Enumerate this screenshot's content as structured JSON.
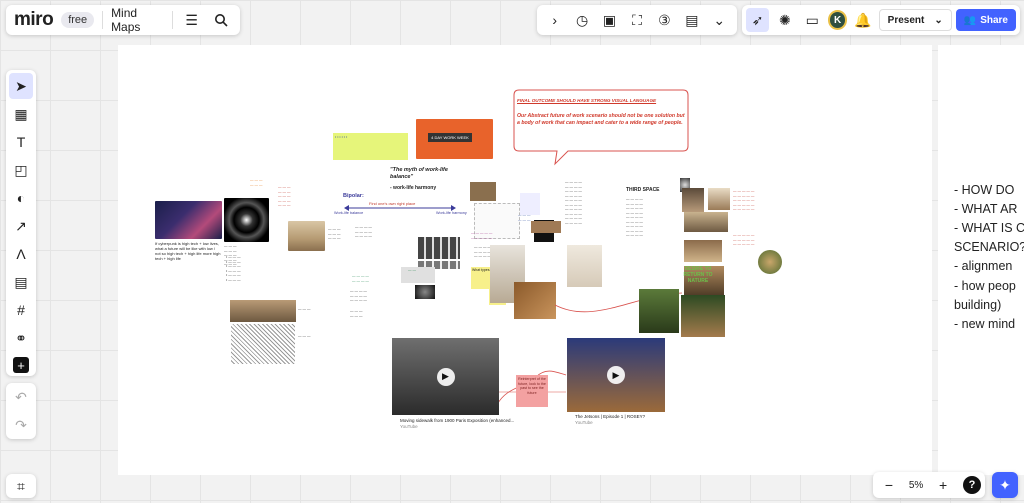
{
  "app": {
    "logo": "miro",
    "plan_badge": "free",
    "board_title": "Mind Maps",
    "menu_icon": "hamburger-icon",
    "search_icon": "search-icon"
  },
  "toolbar_top": {
    "icons": [
      "chevron-right-icon",
      "timer-icon",
      "voting-icon",
      "focus-icon",
      "card-3-icon",
      "notes-icon",
      "chevrons-down-icon"
    ]
  },
  "header_right": {
    "avatar_initial": "K",
    "present_label": "Present",
    "share_label": "Share",
    "accent": "#4262ff"
  },
  "left_tools": [
    "cursor-icon",
    "table-icon",
    "text-icon",
    "sticky-note-icon",
    "shapes-icon",
    "connector-icon",
    "pen-icon",
    "comment-icon",
    "frame-icon",
    "diagram-icon",
    "plus-icon"
  ],
  "zoom": {
    "minus": "−",
    "level": "5%",
    "plus": "+",
    "help": "?"
  },
  "right_frame_lines": [
    "- HOW DO",
    "- WHAT AR",
    "- WHAT IS C",
    "SCENARIO?",
    "- alignmen",
    "- how peop",
    "building)",
    "- new mind"
  ],
  "canvas": {
    "final_outcome_title": "FINAL OUTCOME SHOULD HAVE STRONG VISUAL LANGUAGE",
    "final_outcome_body": "Our Abstract future of work scenario should not be one solution but a body of work that can impact and cater to a wide range of people.",
    "myth_quote": "\"The myth of work-life balance\"",
    "work_life_harmony": "- work-life harmony",
    "bipolar_label": "Bipolar:",
    "find_balance": "Find one's own right place",
    "work_life_balance_label": "Work-life balance",
    "work_life_harmony_label": "Work-life harmony",
    "third_space": "THIRD SPACE",
    "desire_to_return": "DESIRE TO RETURN TO NATURE",
    "sticky_pink": "Reinterpret of the future, look to the past to see the future",
    "sticky_yellow_1": "What types...",
    "sticky_yellow_2": "Impact...",
    "video1_title": "Moving sidewalk from 1900 Paris Exposition (enhanced...",
    "video1_source": "YouTube",
    "video2_title": "The Jetsons | Episode 1 | ROSEY?",
    "video2_source": "YouTube",
    "cyberpunk_text": "If cyberpunk is high tech + low lives, what a future will be like with low / not so high tech + high life more high tech + high life",
    "cube_label": "4 DAY WORK WEEK",
    "colors": {
      "red_outline": "#d9534f",
      "red_text": "#d0392b",
      "blue_arrow": "#3b3b9a",
      "green_text": "#6cc04a",
      "yellow": "#f7f08b",
      "pink": "#f3a1a1"
    }
  }
}
